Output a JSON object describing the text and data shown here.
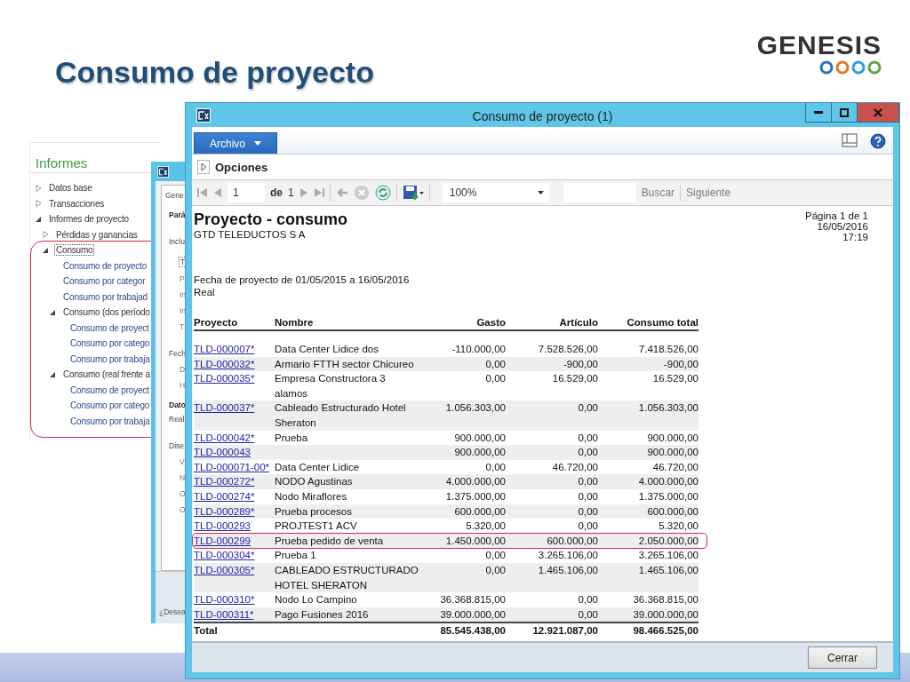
{
  "slide": {
    "title": "Consumo de proyecto",
    "logo": "GENESIS"
  },
  "tree": {
    "title": "Informes",
    "items": [
      {
        "label": "Datos base",
        "kind": "folder",
        "expanded": false,
        "selected": false,
        "highlighted": false
      },
      {
        "label": "Transacciones",
        "kind": "folder",
        "expanded": false,
        "selected": false,
        "highlighted": false
      },
      {
        "label": "Informes de proyecto",
        "kind": "folder",
        "expanded": true,
        "selected": false,
        "highlighted": false,
        "children": [
          {
            "label": "Pérdidas y ganancias",
            "kind": "folder",
            "expanded": false,
            "selected": false,
            "highlighted": false
          },
          {
            "label": "Consumo",
            "kind": "folder",
            "expanded": true,
            "selected": true,
            "highlighted": true,
            "children": [
              {
                "label": "Consumo de proyecto",
                "kind": "link",
                "selected": false
              },
              {
                "label": "Consumo por categor",
                "kind": "link",
                "selected": false
              },
              {
                "label": "Consumo por trabajad",
                "kind": "link",
                "selected": false
              },
              {
                "label": "Consumo (dos período",
                "kind": "folder",
                "expanded": true,
                "selected": false,
                "highlighted": false,
                "children": [
                  {
                    "label": "Consumo de proyect",
                    "kind": "link",
                    "selected": false
                  },
                  {
                    "label": "Consumo por catego",
                    "kind": "link",
                    "selected": false
                  },
                  {
                    "label": "Consumo por trabaja",
                    "kind": "link",
                    "selected": false
                  }
                ]
              },
              {
                "label": "Consumo (real frente a",
                "kind": "folder",
                "expanded": true,
                "selected": false,
                "highlighted": false,
                "children": [
                  {
                    "label": "Consumo de proyect",
                    "kind": "link",
                    "selected": false
                  },
                  {
                    "label": "Consumo por catego",
                    "kind": "link",
                    "selected": false
                  },
                  {
                    "label": "Consumo por trabaja",
                    "kind": "link",
                    "selected": false
                  }
                ]
              }
            ]
          }
        ]
      }
    ]
  },
  "dialog": {
    "lines": [
      {
        "text": "Gene",
        "kind": "tab"
      },
      {
        "text": "Pará",
        "kind": "heading"
      },
      {
        "text": "Inclu",
        "kind": "section"
      },
      {
        "text": "T",
        "kind": "checkbox"
      },
      {
        "text": "P",
        "kind": "option"
      },
      {
        "text": "In",
        "kind": "option"
      },
      {
        "text": "In",
        "kind": "option"
      },
      {
        "text": "T",
        "kind": "option"
      },
      {
        "text": "Fech",
        "kind": "section"
      },
      {
        "text": "D",
        "kind": "option"
      },
      {
        "text": "H",
        "kind": "option"
      },
      {
        "text": "Dato",
        "kind": "heading"
      },
      {
        "text": "Real",
        "kind": "value"
      },
      {
        "text": "Dise",
        "kind": "section"
      },
      {
        "text": "V",
        "kind": "option"
      },
      {
        "text": "N",
        "kind": "option"
      },
      {
        "text": "O",
        "kind": "option"
      },
      {
        "text": "O",
        "kind": "option"
      }
    ],
    "footer": "¿Desea"
  },
  "window": {
    "title": "Consumo de proyecto (1)",
    "menu": "Archivo",
    "options": "Opciones",
    "toolbar": {
      "page": "1",
      "of_label": "de",
      "total_pages": "1",
      "zoom": "100%",
      "find": "Buscar",
      "next": "Siguiente"
    },
    "report": {
      "title": "Proyecto - consumo",
      "company": "GTD TELEDUCTOS S A",
      "page_info": "Página 1 de 1",
      "date": "16/05/2016",
      "time": "17:19",
      "period": "Fecha de proyecto de 01/05/2015 a 16/05/2016",
      "type": "Real",
      "columns": [
        "Proyecto",
        "Nombre",
        "Gasto",
        "Artículo",
        "Consumo total"
      ],
      "rows": [
        {
          "project": "TLD-000007*",
          "name": "Data Center Lidice dos",
          "expense": "-110.000,00",
          "item": "7.528.526,00",
          "total": "7.418.526,00",
          "highlighted": false
        },
        {
          "project": "TLD-000032*",
          "name": "Armario FTTH sector Chicureo",
          "expense": "0,00",
          "item": "-900,00",
          "total": "-900,00",
          "highlighted": false
        },
        {
          "project": "TLD-000035*",
          "name": "Empresa Constructora 3 alamos",
          "expense": "0,00",
          "item": "16.529,00",
          "total": "16.529,00",
          "highlighted": false
        },
        {
          "project": "TLD-000037*",
          "name": "Cableado Estructurado Hotel Sheraton",
          "expense": "1.056.303,00",
          "item": "0,00",
          "total": "1.056.303,00",
          "highlighted": false
        },
        {
          "project": "TLD-000042*",
          "name": "Prueba",
          "expense": "900.000,00",
          "item": "0,00",
          "total": "900.000,00",
          "highlighted": false
        },
        {
          "project": "TLD-000043",
          "expense": "900.000,00",
          "item": "0,00",
          "total": "900.000,00",
          "highlighted": false
        },
        {
          "project": "TLD-000071-00*",
          "name": "Data Center Lidice",
          "expense": "0,00",
          "item": "46.720,00",
          "total": "46.720,00",
          "highlighted": false
        },
        {
          "project": "TLD-000272*",
          "name": "NODO Agustinas",
          "expense": "4.000.000,00",
          "item": "0,00",
          "total": "4.000.000,00",
          "highlighted": false
        },
        {
          "project": "TLD-000274*",
          "name": "Nodo Miraflores",
          "expense": "1.375.000,00",
          "item": "0,00",
          "total": "1.375.000,00",
          "highlighted": false
        },
        {
          "project": "TLD-000289*",
          "name": "Prueba procesos",
          "expense": "600.000,00",
          "item": "0,00",
          "total": "600.000,00",
          "highlighted": false
        },
        {
          "project": "TLD-000293",
          "name": "PROJTEST1 ACV",
          "expense": "5.320,00",
          "item": "0,00",
          "total": "5.320,00",
          "highlighted": false
        },
        {
          "project": "TLD-000299",
          "name": "Prueba pedido de venta",
          "expense": "1.450.000,00",
          "item": "600.000,00",
          "total": "2.050.000,00",
          "highlighted": true
        },
        {
          "project": "TLD-000304*",
          "name": "Prueba 1",
          "expense": "0,00",
          "item": "3.265.106,00",
          "total": "3.265.106,00",
          "highlighted": false
        },
        {
          "project": "TLD-000305*",
          "name": "CABLEADO ESTRUCTURADO HOTEL SHERATON",
          "expense": "0,00",
          "item": "1.465.106,00",
          "total": "1.465.106,00",
          "highlighted": false
        },
        {
          "project": "TLD-000310*",
          "name": "Nodo Lo Campino",
          "expense": "36.368.815,00",
          "item": "0,00",
          "total": "36.368.815,00",
          "highlighted": false
        },
        {
          "project": "TLD-000311*",
          "name": "Pago Fusiones 2016",
          "expense": "39.000.000,00",
          "item": "0,00",
          "total": "39.000.000,00",
          "highlighted": false
        }
      ],
      "total": {
        "label": "Total",
        "expense": "85.545.438,00",
        "item": "12.921.087,00",
        "total": "98.466.525,00"
      }
    },
    "close_button": "Cerrar"
  }
}
